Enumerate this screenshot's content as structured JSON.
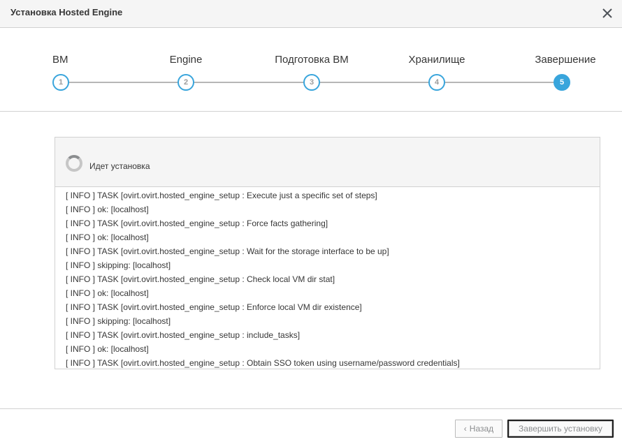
{
  "dialog": {
    "title": "Установка Hosted Engine"
  },
  "icons": {
    "close": "close-icon",
    "spinner": "spinner-icon",
    "back": "chevron-left-icon"
  },
  "colors": {
    "accent": "#39a5dc",
    "track": "#b6b6b6",
    "header_bg": "#f5f5f5"
  },
  "wizard": {
    "steps": [
      {
        "number": "1",
        "label": "ВМ",
        "state": "done"
      },
      {
        "number": "2",
        "label": "Engine",
        "state": "done"
      },
      {
        "number": "3",
        "label": "Подготовка ВМ",
        "state": "done"
      },
      {
        "number": "4",
        "label": "Хранилище",
        "state": "done"
      },
      {
        "number": "5",
        "label": "Завершение",
        "state": "active"
      }
    ]
  },
  "progress": {
    "status": "Идет установка",
    "log": [
      "[ INFO ] TASK [ovirt.ovirt.hosted_engine_setup : Execute just a specific set of steps]",
      "[ INFO ] ok: [localhost]",
      "[ INFO ] TASK [ovirt.ovirt.hosted_engine_setup : Force facts gathering]",
      "[ INFO ] ok: [localhost]",
      "[ INFO ] TASK [ovirt.ovirt.hosted_engine_setup : Wait for the storage interface to be up]",
      "[ INFO ] skipping: [localhost]",
      "[ INFO ] TASK [ovirt.ovirt.hosted_engine_setup : Check local VM dir stat]",
      "[ INFO ] ok: [localhost]",
      "[ INFO ] TASK [ovirt.ovirt.hosted_engine_setup : Enforce local VM dir existence]",
      "[ INFO ] skipping: [localhost]",
      "[ INFO ] TASK [ovirt.ovirt.hosted_engine_setup : include_tasks]",
      "[ INFO ] ok: [localhost]",
      "[ INFO ] TASK [ovirt.ovirt.hosted_engine_setup : Obtain SSO token using username/password credentials]"
    ]
  },
  "footer": {
    "back_label": "Назад",
    "finish_label": "Завершить установку"
  }
}
